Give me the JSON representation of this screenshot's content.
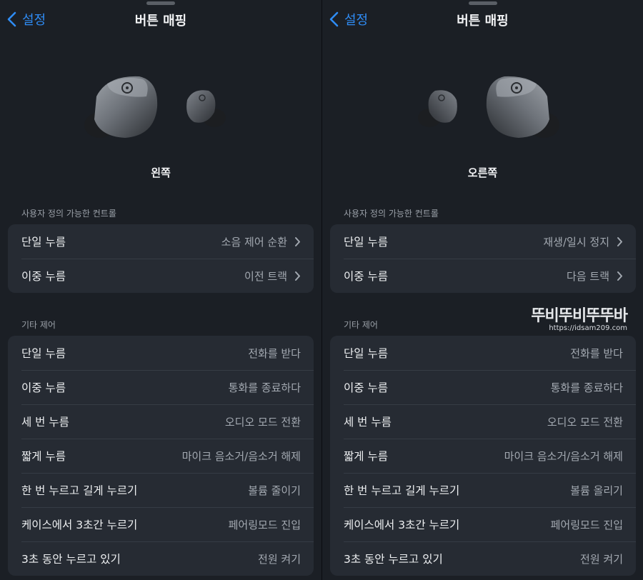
{
  "screens": [
    {
      "nav": {
        "back_label": "설정",
        "title": "버튼 매핑"
      },
      "side_label": "왼쪽",
      "custom_section": {
        "title": "사용자 정의 가능한 컨트롤",
        "rows": [
          {
            "label": "단일 누름",
            "value": "소음 제어 순환"
          },
          {
            "label": "이중 누름",
            "value": "이전 트랙"
          }
        ]
      },
      "other_section": {
        "title": "기타 제어",
        "rows": [
          {
            "label": "단일 누름",
            "value": "전화를 받다"
          },
          {
            "label": "이중 누름",
            "value": "통화를 종료하다"
          },
          {
            "label": "세 번 누름",
            "value": "오디오 모드 전환"
          },
          {
            "label": "짧게 누름",
            "value": "마이크 음소거/음소거 해제"
          },
          {
            "label": "한 번 누르고 길게 누르기",
            "value": "볼륨 줄이기"
          },
          {
            "label": "케이스에서 3초간 누르기",
            "value": "페어링모드 진입"
          },
          {
            "label": "3초 동안 누르고 있기",
            "value": "전원 켜기"
          }
        ]
      }
    },
    {
      "nav": {
        "back_label": "설정",
        "title": "버튼 매핑"
      },
      "side_label": "오른쪽",
      "custom_section": {
        "title": "사용자 정의 가능한 컨트롤",
        "rows": [
          {
            "label": "단일 누름",
            "value": "재생/일시 정지"
          },
          {
            "label": "이중 누름",
            "value": "다음 트랙"
          }
        ]
      },
      "other_section": {
        "title": "기타 제어",
        "rows": [
          {
            "label": "단일 누름",
            "value": "전화를 받다"
          },
          {
            "label": "이중 누름",
            "value": "통화를 종료하다"
          },
          {
            "label": "세 번 누름",
            "value": "오디오 모드 전환"
          },
          {
            "label": "짧게 누름",
            "value": "마이크 음소거/음소거 해제"
          },
          {
            "label": "한 번 누르고 길게 누르기",
            "value": "볼륨 올리기"
          },
          {
            "label": "케이스에서 3초간 누르기",
            "value": "페어링모드 진입"
          },
          {
            "label": "3초 동안 누르고 있기",
            "value": "전원 켜기"
          }
        ]
      }
    }
  ],
  "watermark": {
    "logo": "뚜비뚜비뚜뚜바",
    "url": "https://idsam209.com"
  },
  "icons": {
    "back": "chevron-left-icon",
    "row_arrow": "chevron-right-icon",
    "product": "earbuds-image"
  },
  "colors": {
    "accent": "#2f8cf5",
    "background": "#1b1f25",
    "card": "#262b33"
  }
}
